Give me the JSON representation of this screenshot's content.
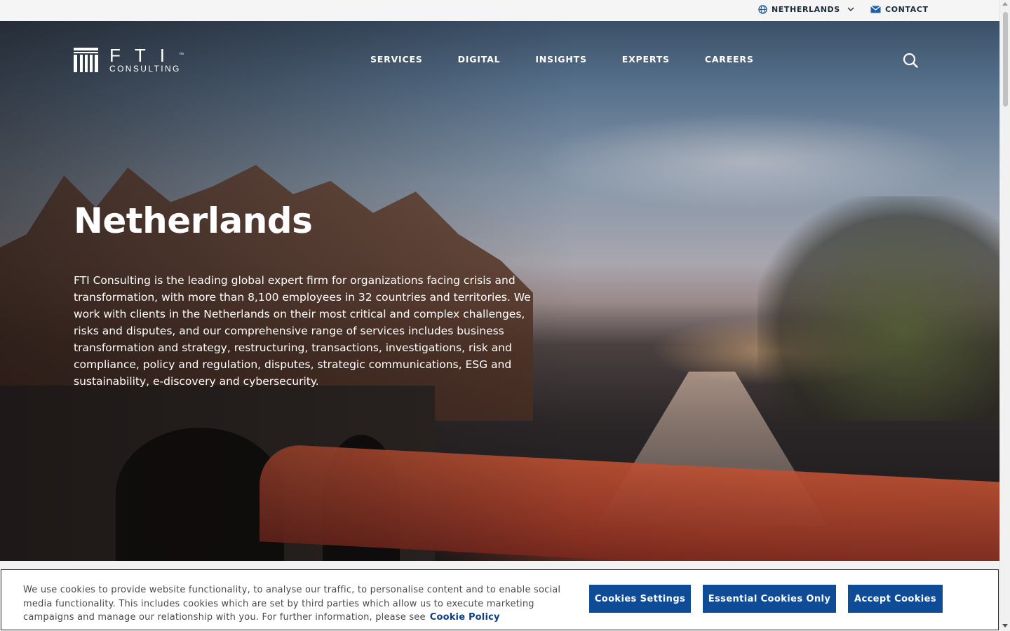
{
  "utility_bar": {
    "country_label": "NETHERLANDS",
    "contact_label": "CONTACT"
  },
  "header": {
    "logo_brand": "FTI",
    "logo_tm": "™",
    "logo_sub": "CONSULTING",
    "nav": [
      "SERVICES",
      "DIGITAL",
      "INSIGHTS",
      "EXPERTS",
      "CAREERS"
    ]
  },
  "hero": {
    "title": "Netherlands",
    "description": "FTI Consulting is the leading global expert firm for organizations facing crisis and transformation, with more than 8,100 employees in 32 countries and territories. We work with clients in the Netherlands on their most critical and complex challenges, risks and disputes, and our comprehensive range of services includes business transformation and strategy, restructuring, transactions, investigations, risk and compliance, policy and regulation, disputes, strategic communications, ESG and sustainability, e-discovery and cybersecurity."
  },
  "cookie_banner": {
    "text": "We use cookies to provide website functionality, to analyse our traffic, to personalise content and to enable social media functionality. This includes cookies which are set by third parties which allow us to execute marketing campaigns and manage our relationship with you. For further information, please see",
    "link": "Cookie Policy",
    "buttons": {
      "settings": "Cookies Settings",
      "essential": "Essential Cookies Only",
      "accept": "Accept Cookies"
    }
  },
  "colors": {
    "brand_blue": "#0f4c97",
    "link_blue": "#0c3f8a",
    "utility_text": "#1c2b3a"
  },
  "icons": [
    "globe-icon",
    "chevron-down-icon",
    "mail-icon",
    "search-icon",
    "fti-logo-mark"
  ]
}
